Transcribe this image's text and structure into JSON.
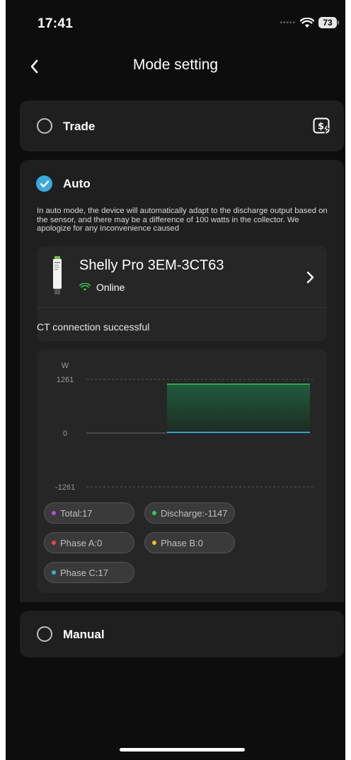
{
  "status_bar": {
    "time": "17:41",
    "battery": "73"
  },
  "header": {
    "title": "Mode setting"
  },
  "trade": {
    "label": "Trade"
  },
  "auto": {
    "label": "Auto",
    "description": "In auto mode, the device will automatically adapt to the discharge output based on the sensor, and there may be a difference of 100 watts in the collector. We apologize for any inconvenience caused",
    "device": {
      "name": "Shelly Pro 3EM-3CT63",
      "status": "Online",
      "ct_status": "CT connection successful"
    }
  },
  "manual": {
    "label": "Manual"
  },
  "colors": {
    "accent": "#3aa9dd",
    "online": "#35c759",
    "total": "#b44fe0",
    "discharge": "#35c759",
    "phase_a": "#e5484d",
    "phase_b": "#f5b82e",
    "phase_c": "#35b3d9"
  },
  "chart_data": {
    "type": "area",
    "ylabel": "W",
    "ylim": [
      -1261,
      1261
    ],
    "y_ticks": [
      "1261",
      "0",
      "-1261"
    ],
    "series": [
      {
        "name": "Discharge",
        "values": [
          1147,
          1147
        ]
      },
      {
        "name": "Total",
        "values": [
          17,
          17
        ]
      }
    ],
    "legend": [
      {
        "text": "Total:17",
        "color": "#b44fe0"
      },
      {
        "text": "Discharge:-1147",
        "color": "#35c759"
      },
      {
        "text": "Phase A:0",
        "color": "#e5484d"
      },
      {
        "text": "Phase B:0",
        "color": "#f5b82e"
      },
      {
        "text": "Phase C:17",
        "color": "#35b3d9"
      }
    ]
  }
}
